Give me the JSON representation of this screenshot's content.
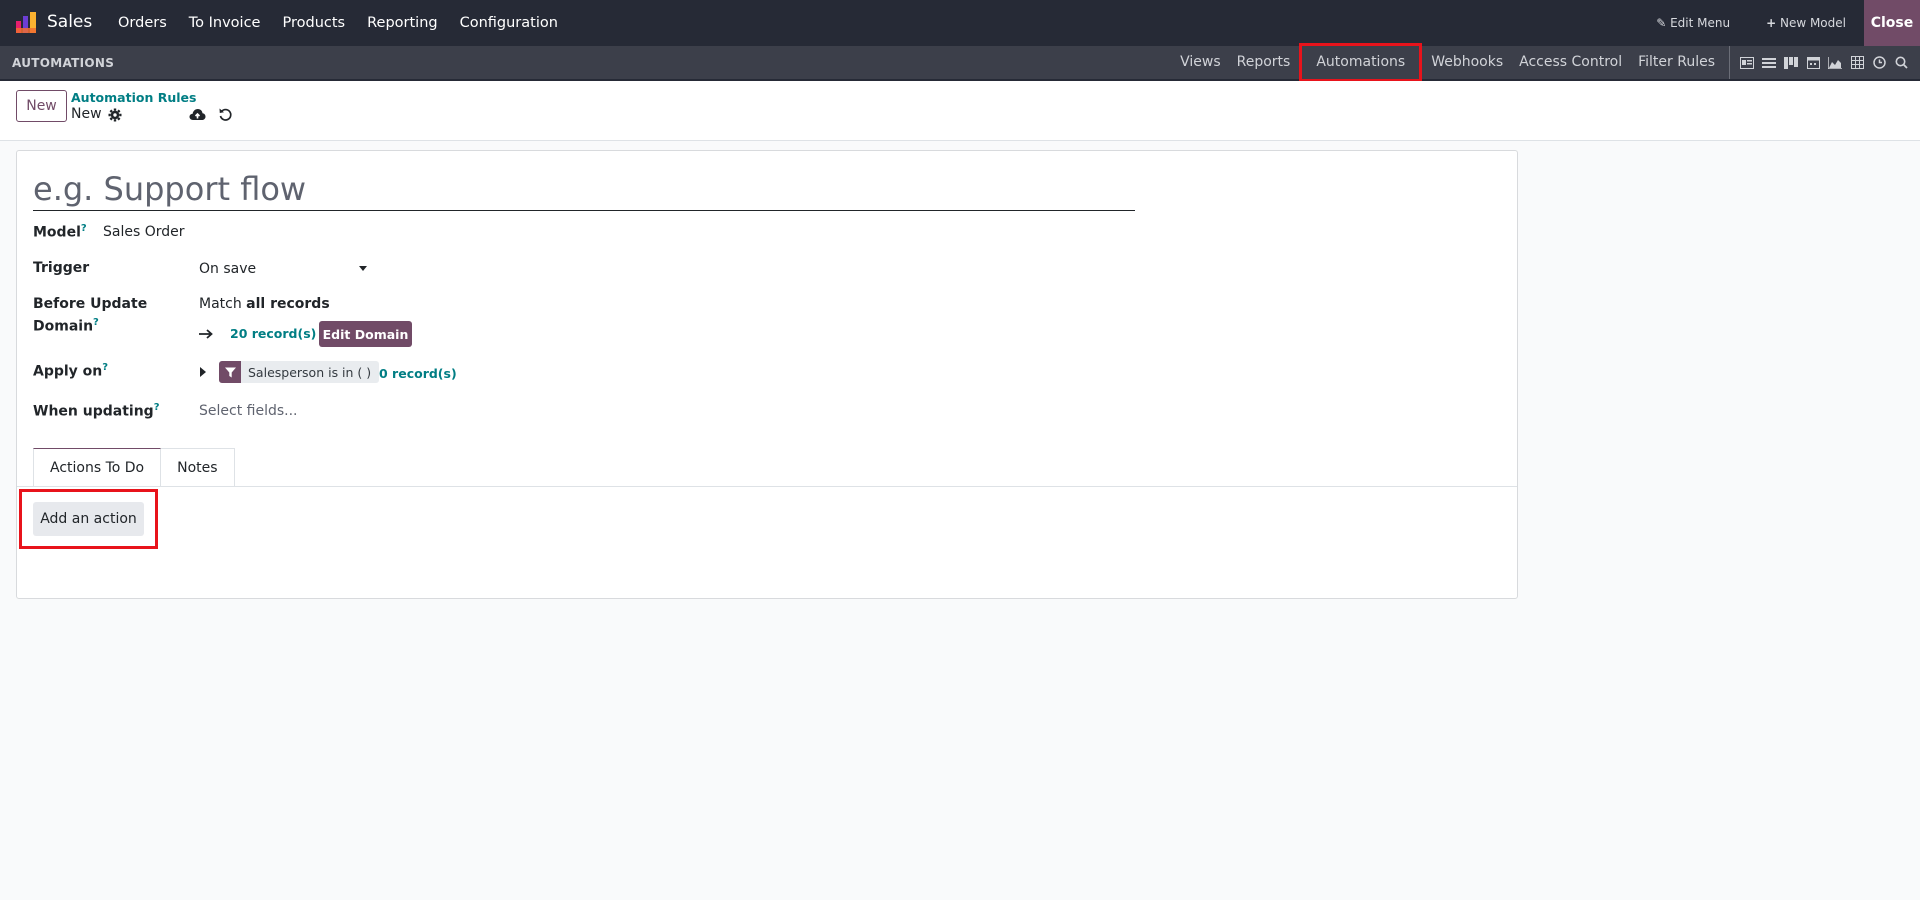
{
  "app": {
    "name": "Sales",
    "logo_colors": [
      "#f16d30",
      "#e61f6e",
      "#6c3ed4",
      "#fbb130"
    ]
  },
  "top_menu": [
    "Orders",
    "To Invoice",
    "Products",
    "Reporting",
    "Configuration"
  ],
  "top_right": {
    "edit_menu": "Edit Menu",
    "new_model": "New Model",
    "close": "Close"
  },
  "subbar": {
    "title": "AUTOMATIONS",
    "menu": [
      "Views",
      "Reports",
      "Automations",
      "Webhooks",
      "Access Control",
      "Filter Rules"
    ],
    "highlighted": "Automations",
    "view_icons": [
      "form-view-icon",
      "list-view-icon",
      "kanban-view-icon",
      "calendar-view-icon",
      "graph-view-icon",
      "pivot-view-icon",
      "activity-view-icon",
      "search-icon"
    ]
  },
  "control_panel": {
    "new_label": "New",
    "breadcrumb_parent": "Automation Rules",
    "breadcrumb_current": "New"
  },
  "form": {
    "name_placeholder": "e.g. Support flow",
    "model_label": "Model",
    "model_value": "Sales Order",
    "trigger_label": "Trigger",
    "trigger_value": "On save",
    "before_update_label_1": "Before Update",
    "before_update_label_2": "Domain",
    "match_prefix": "Match",
    "match_value": "all records",
    "before_records": "20 record(s)",
    "edit_domain": "Edit Domain",
    "apply_on_label": "Apply on",
    "apply_on_chip": "Salesperson is in ( )",
    "apply_records": "0 record(s)",
    "when_updating_label": "When updating",
    "when_updating_placeholder": "Select fields...",
    "help_mark": "?"
  },
  "tabs": [
    "Actions To Do",
    "Notes"
  ],
  "add_action_label": "Add an action",
  "colors": {
    "brand": "#714b67",
    "link": "#017e84",
    "highlight": "#e8131b",
    "navbar": "#262a36"
  }
}
